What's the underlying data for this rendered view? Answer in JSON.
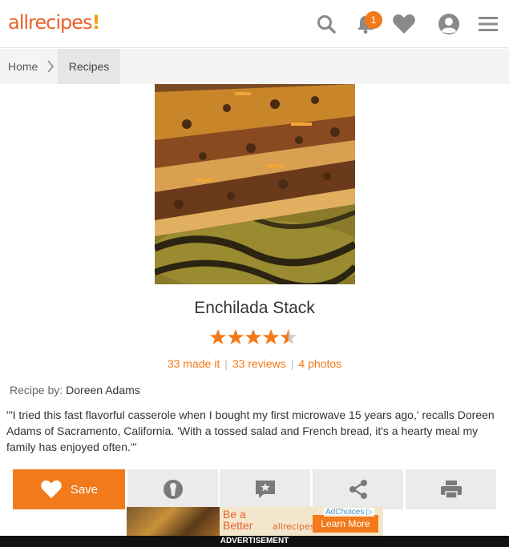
{
  "header": {
    "logo_text": "allrecipes",
    "logo_mark": "!",
    "notification_count": "1",
    "icons": [
      "search-icon",
      "bell-icon",
      "heart-icon",
      "profile-icon",
      "menu-icon"
    ]
  },
  "breadcrumb": {
    "home": "Home",
    "current": "Recipes"
  },
  "recipe": {
    "title": "Enchilada Stack",
    "rating": 4.5,
    "made_it": "33 made it",
    "reviews": "33 reviews",
    "photos": "4 photos",
    "byline_label": "Recipe by:",
    "author": "Doreen Adams",
    "description": "\"'I tried this fast flavorful casserole when I bought my first microwave 15 years ago,' recalls Doreen Adams of Sacramento, California. 'With a tossed salad and French bread, it's a hearty meal my family has enjoyed often.'\""
  },
  "actions": {
    "save_label": "Save",
    "icons": [
      "heart-icon",
      "made-it-icon",
      "review-icon",
      "share-icon",
      "print-icon"
    ]
  },
  "ad": {
    "headline_line1": "Be a",
    "headline_line2": "Better",
    "brand": "allrecipes",
    "cta": "Learn More",
    "choices": "AdChoices",
    "label": "ADVERTISEMENT"
  },
  "colors": {
    "brand_orange": "#f27a1a",
    "logo_orange": "#e8622a",
    "icon_gray": "#8a8a8a"
  }
}
